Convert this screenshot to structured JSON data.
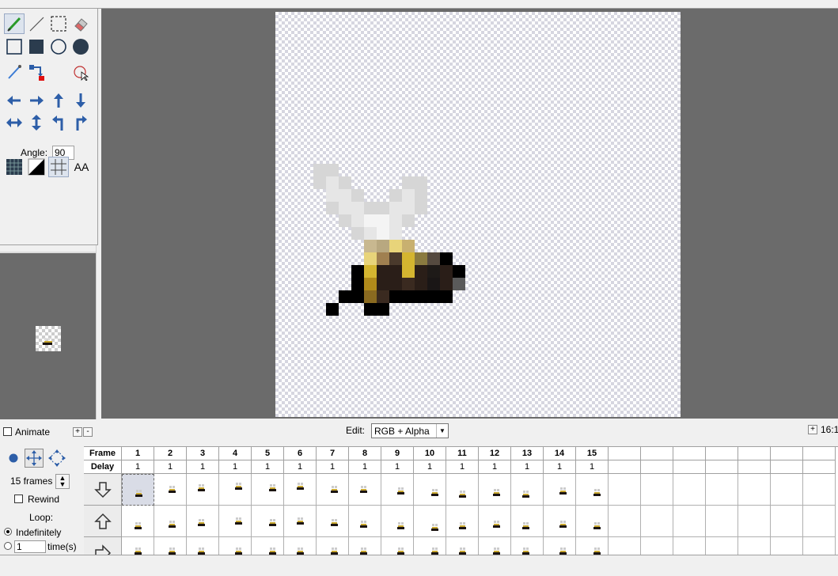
{
  "tool_panel": {
    "angle_label": "Angle:",
    "angle_value": "90",
    "aa_label": "AA"
  },
  "status": {
    "animate_label": "Animate",
    "edit_label": "Edit:",
    "edit_mode": "RGB + Alpha",
    "zoom": "16:1",
    "plus": "+",
    "minus": "-"
  },
  "timeline": {
    "frames_count": "15 frames",
    "rewind_label": "Rewind",
    "loop_label": "Loop:",
    "indefinitely_label": "Indefinitely",
    "times_value": "1",
    "times_label": "time(s)",
    "header_frame": "Frame",
    "header_delay": "Delay",
    "frames": [
      "1",
      "2",
      "3",
      "4",
      "5",
      "6",
      "7",
      "8",
      "9",
      "10",
      "11",
      "12",
      "13",
      "14",
      "15"
    ],
    "delays": [
      "1",
      "1",
      "1",
      "1",
      "1",
      "1",
      "1",
      "1",
      "1",
      "1",
      "1",
      "1",
      "1",
      "1",
      "1"
    ],
    "rows": [
      "down-arrow",
      "up-arrow",
      "right-arrow"
    ]
  },
  "colors": {
    "canvas_bg": "#6b6b6b",
    "tool_blue": "#2d5ea8",
    "selection": "#d9dce6"
  }
}
